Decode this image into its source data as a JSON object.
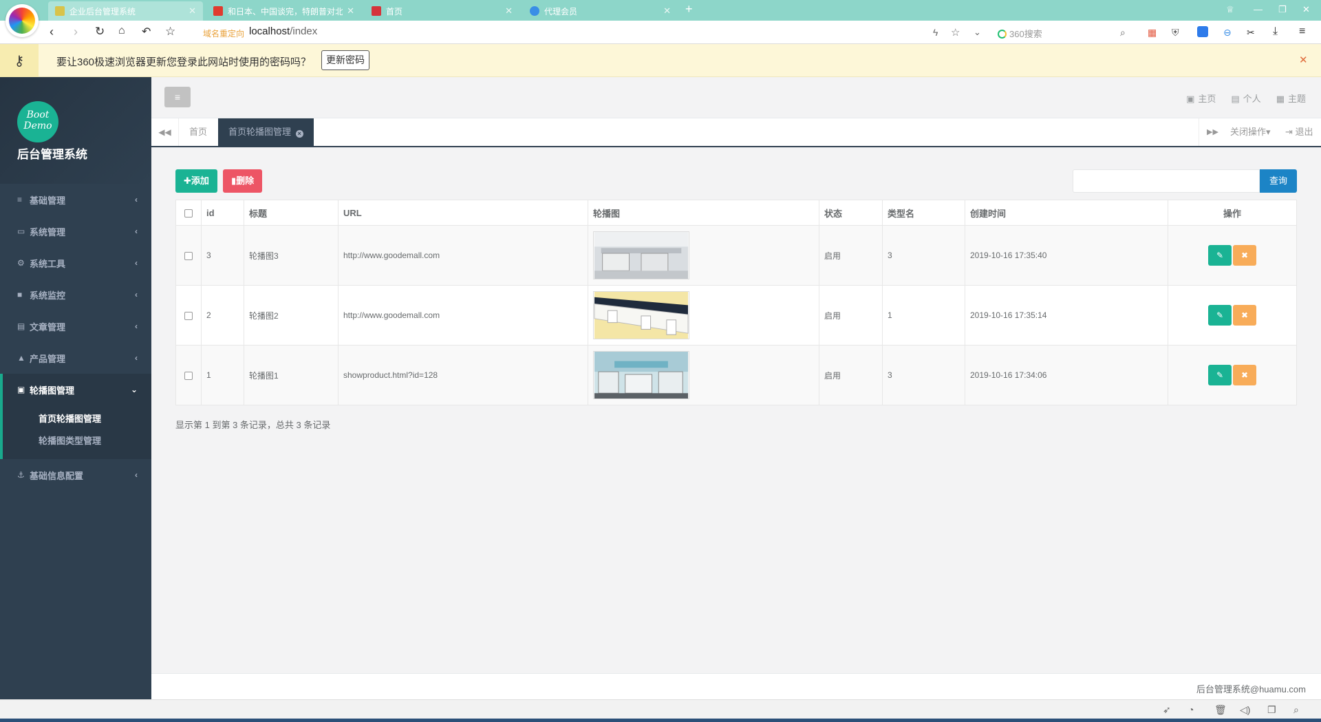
{
  "browser": {
    "tabs": [
      {
        "title": "企业后台管理系统",
        "active": true,
        "favcolor": "#d8c34a"
      },
      {
        "title": "和日本、中国谈完，特朗普对北…",
        "active": false,
        "favcolor": "#e03b2e"
      },
      {
        "title": "首页",
        "active": false,
        "favcolor": "#d5343a"
      },
      {
        "title": "代理会员",
        "active": false,
        "favcolor": "#3a8ee6"
      }
    ],
    "new_tab": "+",
    "redirect_label": "域名重定向",
    "url_host": "localhost",
    "url_path": "/index",
    "search_placeholder": "360搜索"
  },
  "password_bar": {
    "message": "要让360极速浏览器更新您登录此网站时使用的密码吗？",
    "button": "更新密码",
    "close": "✕"
  },
  "sidebar": {
    "logo_text_1": "Boot",
    "logo_text_2": "Demo",
    "brand": "后台管理系统",
    "items": [
      {
        "label": "基础管理",
        "icon": "≡"
      },
      {
        "label": "系统管理",
        "icon": "▭"
      },
      {
        "label": "系统工具",
        "icon": "⚙"
      },
      {
        "label": "系统监控",
        "icon": "■"
      },
      {
        "label": "文章管理",
        "icon": "▤"
      },
      {
        "label": "产品管理",
        "icon": "▲"
      }
    ],
    "open_item": {
      "label": "轮播图管理",
      "icon": "▣"
    },
    "sub_items": [
      {
        "label": "首页轮播图管理"
      },
      {
        "label": "轮播图类型管理"
      }
    ],
    "last_item": {
      "label": "基础信息配置",
      "icon": "⚓"
    }
  },
  "topnav": {
    "links": [
      {
        "label": "主页",
        "icon": "▣"
      },
      {
        "label": "个人",
        "icon": "▤"
      },
      {
        "label": "主题",
        "icon": "▦"
      }
    ]
  },
  "content_tabs": {
    "home": "首页",
    "active": "首页轮播图管理",
    "close_ops": "关闭操作▾",
    "logout": "退出"
  },
  "toolbar": {
    "add": "✚添加",
    "delete": "▮删除",
    "query": "查询"
  },
  "table": {
    "headers": [
      "id",
      "标题",
      "URL",
      "轮播图",
      "状态",
      "类型名",
      "创建时间",
      "操作"
    ],
    "rows": [
      {
        "id": "3",
        "title": "轮播图3",
        "url": "http://www.goodemall.com",
        "status": "启用",
        "type": "3",
        "created": "2019-10-16 17:35:40"
      },
      {
        "id": "2",
        "title": "轮播图2",
        "url": "http://www.goodemall.com",
        "status": "启用",
        "type": "1",
        "created": "2019-10-16 17:35:14"
      },
      {
        "id": "1",
        "title": "轮播图1",
        "url": "showproduct.html?id=128",
        "status": "启用",
        "type": "3",
        "created": "2019-10-16 17:34:06"
      }
    ]
  },
  "pagination_info": "显示第 1 到第 3 条记录，总共 3 条记录",
  "footer": {
    "copyright": "后台管理系统@huamu.com"
  },
  "colors": {
    "primary": "#1ab394",
    "danger": "#ed5565",
    "warning": "#f8ac59",
    "info": "#1c84c6",
    "sidebar": "#2f4050"
  }
}
